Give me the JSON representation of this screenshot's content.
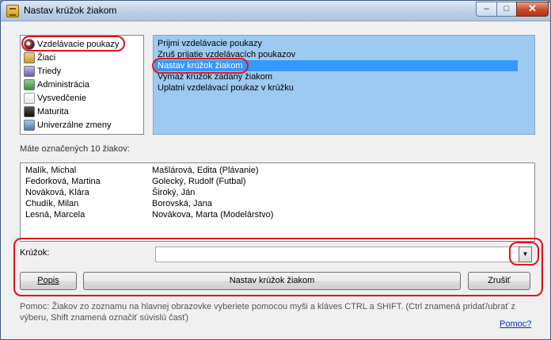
{
  "window": {
    "title": "Nastav krúžok žiakom"
  },
  "sidebar": {
    "items": [
      {
        "label": "Vzdelávacie poukazy",
        "icon": "badge-icon"
      },
      {
        "label": "Žiaci",
        "icon": "students-icon"
      },
      {
        "label": "Triedy",
        "icon": "classes-icon"
      },
      {
        "label": "Administrácia",
        "icon": "admin-icon"
      },
      {
        "label": "Vysvedčenie",
        "icon": "certificate-icon"
      },
      {
        "label": "Maturita",
        "icon": "graduation-icon"
      },
      {
        "label": "Univerzálne zmeny",
        "icon": "global-changes-icon"
      }
    ]
  },
  "actions": {
    "items": [
      "Prijmi vzdelávacie poukazy",
      "Zruš prijatie vzdelávacích poukazov",
      "Nastav krúžok žiakom",
      "Vymaž krúžok zadaný žiakom",
      "Uplatni vzdelávací poukaz v krúžku"
    ],
    "selected": "Nastav krúžok žiakom"
  },
  "students": {
    "count_label": "Máte označených 10 žiakov:",
    "rows": [
      {
        "name": "Malík, Michal",
        "activity": "Mašlárová, Edita (Plávanie)"
      },
      {
        "name": "Fedorková, Martina",
        "activity": "Golecký, Rudolf (Futbal)"
      },
      {
        "name": "Nováková, Klára",
        "activity": "Široký, Ján"
      },
      {
        "name": "Chudík, Milan",
        "activity": "Borovská, Jana"
      },
      {
        "name": "Lesná, Marcela",
        "activity": "Novákova, Marta (Modelárstvo)"
      }
    ]
  },
  "form": {
    "krouzok_label": "Krúžok:",
    "krouzok_value": "",
    "popis_label": "Popis",
    "submit_label": "Nastav krúžok žiakom",
    "cancel_label": "Zrušiť"
  },
  "help": {
    "text": "Pomoc: Žiakov zo zoznamu na hlavnej obrazovke vyberiete pomocou myši a kláves CTRL a SHIFT. (Ctrl znamená pridať/ubrať z výberu, Shift znamená označiť súvislú časť)",
    "link_label": "Pomoc?"
  },
  "colors": {
    "selection": "#3399ff",
    "action_panel": "#9ccaf0",
    "highlight_ring": "#e0151f",
    "link": "#0033cc"
  }
}
